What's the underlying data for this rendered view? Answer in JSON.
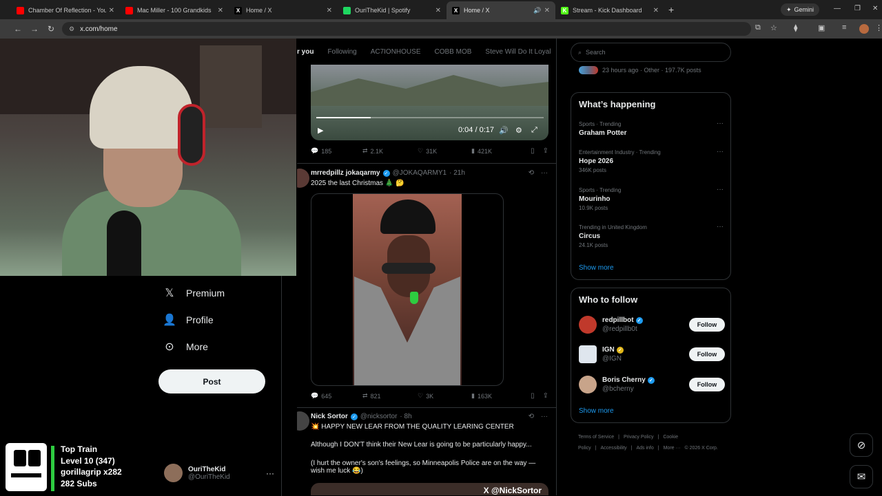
{
  "browser": {
    "tabs": [
      {
        "title": "Chamber Of Reflection - YouTube",
        "favicon": "youtube-icon",
        "color": "#ff0000",
        "active": false
      },
      {
        "title": "Mac Miller - 100 Grandkids",
        "favicon": "youtube-icon",
        "color": "#ff0000",
        "active": false
      },
      {
        "title": "Home / X",
        "favicon": "x-icon",
        "color": "#000000",
        "active": false
      },
      {
        "title": "OuriTheKid | Spotify",
        "favicon": "spotify-icon",
        "color": "#1ed760",
        "active": false
      },
      {
        "title": "Home / X",
        "favicon": "x-icon",
        "color": "#000000",
        "active": true
      },
      {
        "title": "Stream - Kick Dashboard",
        "favicon": "kick-icon",
        "color": "#53fc18",
        "active": false
      }
    ],
    "gemini_label": "Gemini",
    "url": "x.com/home"
  },
  "timeline": {
    "tabs": [
      "r you",
      "Following",
      "AC7IONHOUSE",
      "COBB MOB",
      "Steve Will Do It Loyal"
    ],
    "video1": {
      "time": "0:04 / 0:17",
      "progress": 0.24
    },
    "actions1": {
      "replies": "185",
      "reposts": "2.1K",
      "likes": "31K",
      "views": "421K"
    },
    "tweet2": {
      "name": "mrredpillz jokaqarmy",
      "handle": "@JOKAQARMY1",
      "time": "· 21h",
      "text": "2025 the last Christmas 🎄 🤔"
    },
    "actions2": {
      "replies": "645",
      "reposts": "821",
      "likes": "3K",
      "views": "163K"
    },
    "tweet3": {
      "name": "Nick Sortor",
      "handle": "@nicksortor",
      "time": "· 8h",
      "line1": "💥 HAPPY NEW LEAR FROM THE QUALITY LEARING CENTER",
      "line2": "Although I DON'T think their New Lear is going to be particularly happy...",
      "line3": "(I hurt the owner's son's feelings, so Minneapolis Police are on the way — wish me luck 😂)",
      "watermark": "X @NickSortor"
    }
  },
  "nav": {
    "premium": "Premium",
    "profile": "Profile",
    "more": "More",
    "post": "Post",
    "user_name": "OuriTheKid",
    "user_handle": "@OuriTheKid"
  },
  "train_widget": {
    "line1": "Top Train",
    "line2": "Level 10  (347)",
    "line3": "gorillagrip x282",
    "line4": "282 Subs"
  },
  "sidebar": {
    "search_placeholder": "Search",
    "top_meta": "23 hours ago · Other · 197.7K posts",
    "whats_happening": "What’s happening",
    "trends": [
      {
        "meta": "Sports · Trending",
        "title": "Graham Potter",
        "count": ""
      },
      {
        "meta": "Entertainment Industry · Trending",
        "title": "Hope 2026",
        "count": "346K posts"
      },
      {
        "meta": "Sports · Trending",
        "title": "Mourinho",
        "count": "10.9K posts"
      },
      {
        "meta": "Trending in United Kingdom",
        "title": "Circus",
        "count": "24.1K posts"
      }
    ],
    "show_more": "Show more",
    "who_to_follow": "Who to follow",
    "follow": [
      {
        "name": "redpillbot",
        "handle": "@redpillb0t",
        "badge": "blue",
        "follow_label": "Follow"
      },
      {
        "name": "IGN",
        "handle": "@IGN",
        "badge": "gold",
        "follow_label": "Follow"
      },
      {
        "name": "Boris Cherny",
        "handle": "@bcherny",
        "badge": "blue",
        "follow_label": "Follow"
      }
    ],
    "show_more_2": "Show more",
    "footer": [
      "Terms of Service",
      "|",
      "Privacy Policy",
      "|",
      "Cookie Policy",
      "|",
      "Accessibility",
      "|",
      "Ads info",
      "|",
      "More ···",
      "© 2026 X Corp."
    ]
  }
}
